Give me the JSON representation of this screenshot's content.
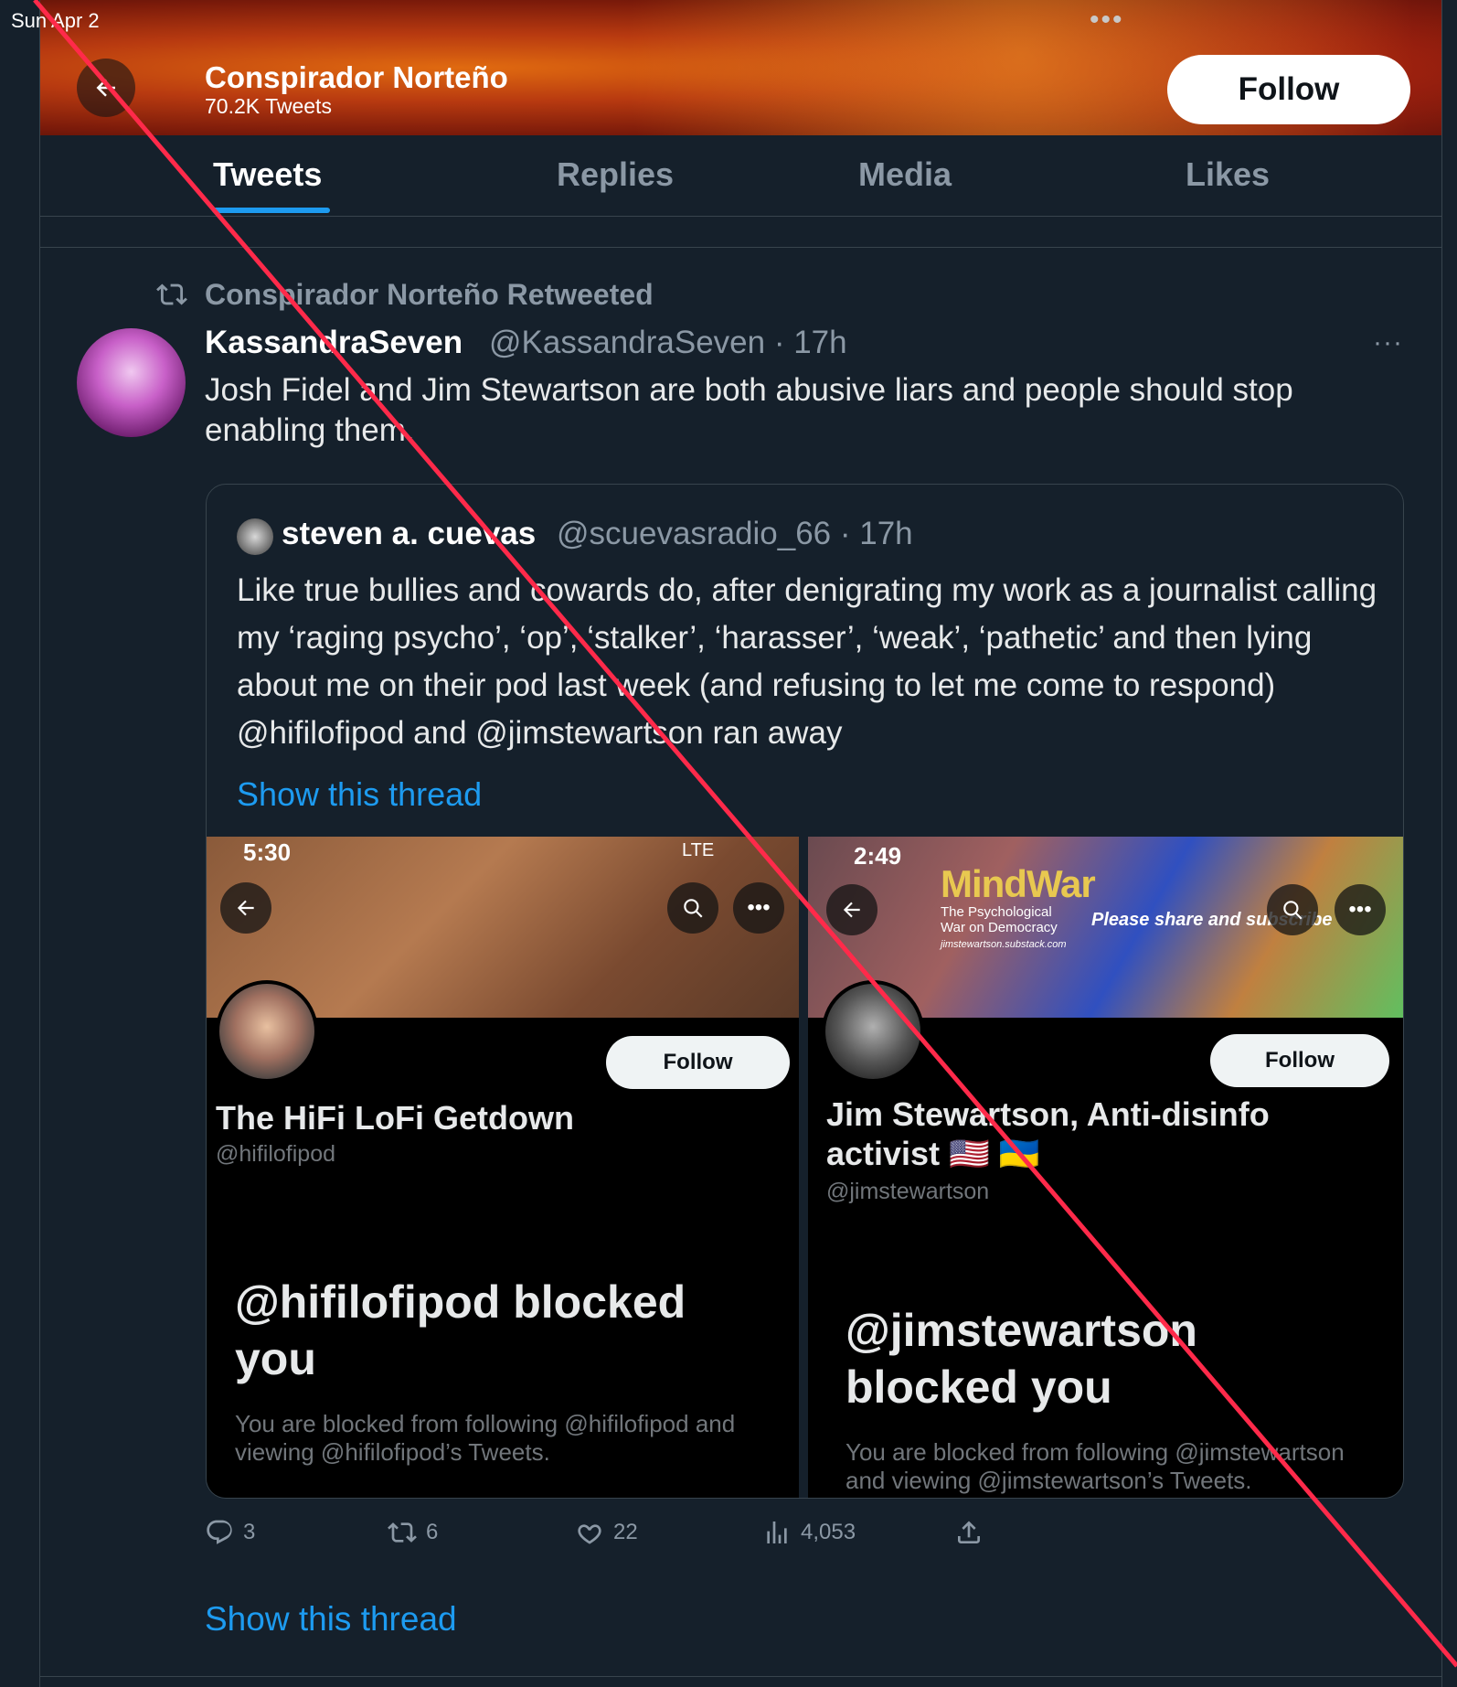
{
  "status_bar": {
    "date": "Sun Apr 2",
    "dots": "•••"
  },
  "header": {
    "name": "Conspirador Norteño",
    "tweet_count": "70.2K Tweets",
    "follow_label": "Follow"
  },
  "tabs": [
    "Tweets",
    "Replies",
    "Media",
    "Likes"
  ],
  "tweet": {
    "retweeted_by": "Conspirador Norteño Retweeted",
    "author_name": "KassandraSeven",
    "author_handle_time": "@KassandraSeven · 17h",
    "more": "···",
    "text": "Josh Fidel and Jim Stewartson are both abusive liars and people should stop enabling them.",
    "quote": {
      "name": "steven a. cuevas",
      "handle_time": "@scuevasradio_66 · 17h",
      "text": "Like true bullies and cowards do, after denigrating my work as a journalist calling my ‘raging psycho’, ‘op’, ‘stalker’, ‘harasser’, ‘weak’, ‘pathetic’ and then lying about me on their pod last week (and refusing to let me come to respond) @hifilofipod and @jimstewartson ran away",
      "show_thread": "Show this thread",
      "screenshots": [
        {
          "time": "5:30",
          "status": "LTE",
          "follow": "Follow",
          "title": "The HiFi LoFi Getdown",
          "handle": "@hifilofipod",
          "blocked": "@hifilofipod blocked you",
          "desc": "You are blocked from following @hifilofipod and viewing @hifilofipod’s Tweets."
        },
        {
          "time": "2:49",
          "follow": "Follow",
          "title": "Jim Stewartson, Anti-disinfo activist 🇺🇸 🇺🇦",
          "handle": "@jimstewartson",
          "blocked": "@jimstewartson blocked you",
          "desc": "You are blocked from following @jimstewartson and viewing @jimstewartson’s Tweets.",
          "banner_title": "MindWar",
          "banner_sub": "The Psychological War on Democracy",
          "banner_url": "jimstewartson.substack.com",
          "banner_cta": "Please share and subscribe"
        }
      ]
    },
    "actions": {
      "replies": "3",
      "retweets": "6",
      "likes": "22",
      "views": "4,053"
    },
    "show_thread": "Show this thread"
  },
  "colors": {
    "background": "#15202b",
    "accent": "#1d9bf0",
    "annotation_line": "#ff2a4a"
  }
}
